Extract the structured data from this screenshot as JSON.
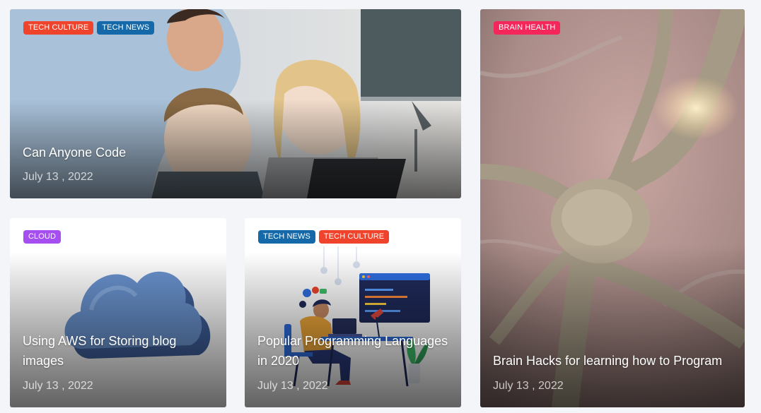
{
  "colors": {
    "tech_culture": "#f0432c",
    "tech_news": "#1569a8",
    "brain_health": "#f5265a",
    "cloud": "#a64ff0"
  },
  "posts": [
    {
      "title": "Can Anyone Code",
      "date": "July 13 , 2022",
      "tags": [
        {
          "label": "TECH CULTURE",
          "color": "#f0432c"
        },
        {
          "label": "TECH NEWS",
          "color": "#1569a8"
        }
      ],
      "image": "kids-coding-photo"
    },
    {
      "title": "Brain Hacks for learning how to Program",
      "date": "July 13 , 2022",
      "tags": [
        {
          "label": "BRAIN HEALTH",
          "color": "#f5265a"
        }
      ],
      "image": "neuron-photo"
    },
    {
      "title": "Using AWS for Storing blog images",
      "date": "July 13 , 2022",
      "tags": [
        {
          "label": "CLOUD",
          "color": "#a64ff0"
        }
      ],
      "image": "cloud-illustration"
    },
    {
      "title": "Popular Programming Languages in 2020",
      "date": "July 13 , 2022",
      "tags": [
        {
          "label": "TECH NEWS",
          "color": "#1569a8"
        },
        {
          "label": "TECH CULTURE",
          "color": "#f0432c"
        }
      ],
      "image": "programmer-illustration"
    }
  ]
}
